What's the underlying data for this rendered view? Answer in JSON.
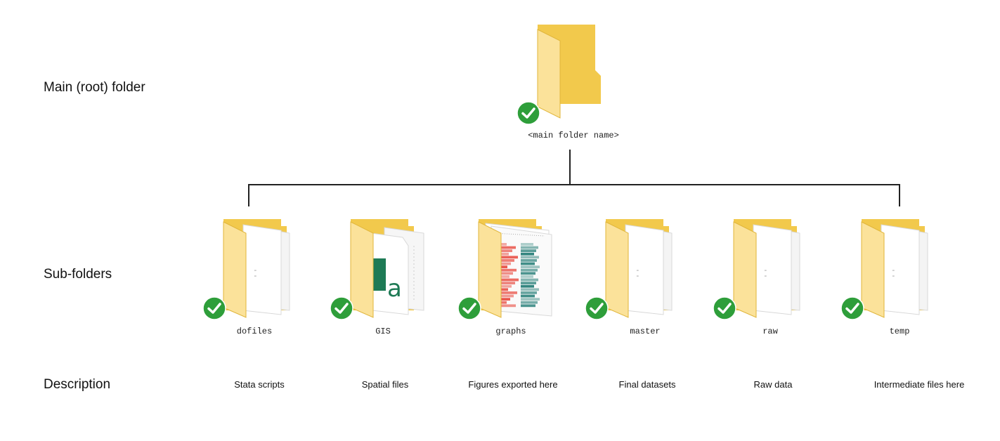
{
  "row_labels": {
    "root": "Main (root) folder",
    "subfolders": "Sub-folders",
    "description": "Description"
  },
  "root_folder": {
    "name": "<main folder name>",
    "icon": "folder-icon",
    "status_icon": "check-icon"
  },
  "subfolders": [
    {
      "name": "dofiles",
      "description": "Stata scripts",
      "preview": "generic"
    },
    {
      "name": "GIS",
      "description": "Spatial files",
      "preview": "font"
    },
    {
      "name": "graphs",
      "description": "Figures exported here",
      "preview": "heatmap"
    },
    {
      "name": "master",
      "description": "Final datasets",
      "preview": "generic"
    },
    {
      "name": "raw",
      "description": "Raw data",
      "preview": "generic"
    },
    {
      "name": "temp",
      "description": "Intermediate files here",
      "preview": "generic"
    }
  ],
  "colors": {
    "folder_back": "#f2c94c",
    "folder_front": "#fbe29a",
    "check_green": "#2e9e3a",
    "line": "#222222",
    "heat_red": "#e8473c",
    "heat_teal": "#1f7a73",
    "font_green": "#1e7a55"
  }
}
